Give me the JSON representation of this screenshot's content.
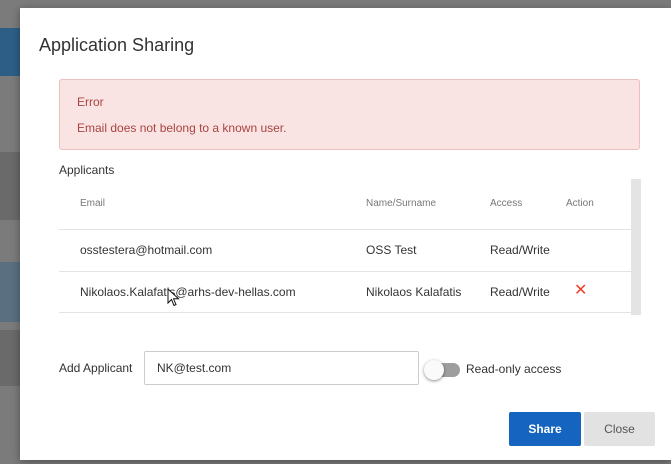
{
  "dialog": {
    "title": "Application Sharing"
  },
  "alert": {
    "title": "Error",
    "message": "Email does not belong to a known user."
  },
  "applicants": {
    "label": "Applicants",
    "columns": {
      "email": "Email",
      "name": "Name/Surname",
      "access": "Access",
      "action": "Action"
    },
    "rows": [
      {
        "email": "osstestera@hotmail.com",
        "name": "OSS Test",
        "access": "Read/Write",
        "removable": false
      },
      {
        "email": "Nikolaos.Kalafatis@arhs-dev-hellas.com",
        "name": "Nikolaos Kalafatis",
        "access": "Read/Write",
        "removable": true
      }
    ],
    "remove_glyph": "✕"
  },
  "add_applicant": {
    "label": "Add Applicant",
    "value": "NK@test.com",
    "readonly_label": "Read-only access",
    "readonly_enabled": false
  },
  "buttons": {
    "share": "Share",
    "close": "Close"
  },
  "colors": {
    "primary": "#1565c0",
    "error_bg": "#f9e4e3",
    "error_text": "#a94442",
    "remove": "#e8402c"
  },
  "icons": {
    "remove": "close-icon",
    "cursor": "mouse-pointer-icon"
  }
}
